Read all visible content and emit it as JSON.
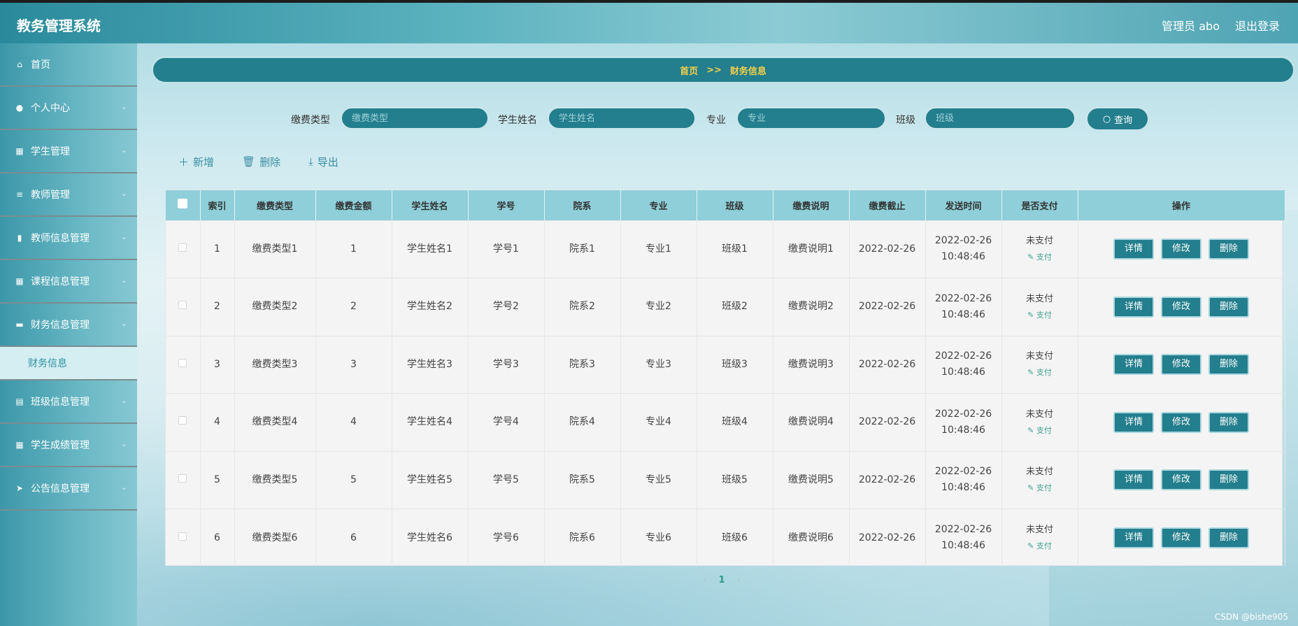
{
  "app": {
    "title": "教务管理系统"
  },
  "header": {
    "user_label": "管理员 abo",
    "logout_label": "退出登录"
  },
  "sidebar": {
    "items": [
      {
        "label": "首页",
        "icon": "home-icon",
        "expandable": false
      },
      {
        "label": "个人中心",
        "icon": "user-icon",
        "expandable": true
      },
      {
        "label": "学生管理",
        "icon": "grid-icon",
        "expandable": true
      },
      {
        "label": "教师管理",
        "icon": "list-icon",
        "expandable": true
      },
      {
        "label": "教师信息管理",
        "icon": "bar-chart-icon",
        "expandable": true
      },
      {
        "label": "课程信息管理",
        "icon": "grid-icon",
        "expandable": true
      },
      {
        "label": "财务信息管理",
        "icon": "wallet-icon",
        "expandable": true
      },
      {
        "label": "班级信息管理",
        "icon": "clipboard-icon",
        "expandable": true
      },
      {
        "label": "学生成绩管理",
        "icon": "grid-icon",
        "expandable": true
      },
      {
        "label": "公告信息管理",
        "icon": "send-icon",
        "expandable": true
      }
    ],
    "active_submenu": {
      "label": "财务信息"
    }
  },
  "breadcrumb": {
    "home": "首页",
    "separator": ">>",
    "current": "财务信息"
  },
  "search": {
    "fee_type": {
      "label": "缴费类型",
      "placeholder": "缴费类型"
    },
    "student_name": {
      "label": "学生姓名",
      "placeholder": "学生姓名"
    },
    "major": {
      "label": "专业",
      "placeholder": "专业"
    },
    "class": {
      "label": "班级",
      "placeholder": "班级"
    },
    "query_label": "查询"
  },
  "toolbar": {
    "add_label": "新增",
    "delete_label": "删除",
    "export_label": "导出"
  },
  "table": {
    "headers": [
      "索引",
      "缴费类型",
      "缴费金额",
      "学生姓名",
      "学号",
      "院系",
      "专业",
      "班级",
      "缴费说明",
      "缴费截止",
      "发送时间",
      "是否支付",
      "操作"
    ],
    "rows": [
      {
        "index": "1",
        "fee_type": "缴费类型1",
        "amount": "1",
        "student_name": "学生姓名1",
        "student_no": "学号1",
        "dept": "院系1",
        "major": "专业1",
        "class": "班级1",
        "desc": "缴费说明1",
        "deadline": "2022-02-26",
        "send_date": "2022-02-26",
        "send_time": "10:48:46",
        "status": "未支付",
        "pay": "支付"
      },
      {
        "index": "2",
        "fee_type": "缴费类型2",
        "amount": "2",
        "student_name": "学生姓名2",
        "student_no": "学号2",
        "dept": "院系2",
        "major": "专业2",
        "class": "班级2",
        "desc": "缴费说明2",
        "deadline": "2022-02-26",
        "send_date": "2022-02-26",
        "send_time": "10:48:46",
        "status": "未支付",
        "pay": "支付"
      },
      {
        "index": "3",
        "fee_type": "缴费类型3",
        "amount": "3",
        "student_name": "学生姓名3",
        "student_no": "学号3",
        "dept": "院系3",
        "major": "专业3",
        "class": "班级3",
        "desc": "缴费说明3",
        "deadline": "2022-02-26",
        "send_date": "2022-02-26",
        "send_time": "10:48:46",
        "status": "未支付",
        "pay": "支付"
      },
      {
        "index": "4",
        "fee_type": "缴费类型4",
        "amount": "4",
        "student_name": "学生姓名4",
        "student_no": "学号4",
        "dept": "院系4",
        "major": "专业4",
        "class": "班级4",
        "desc": "缴费说明4",
        "deadline": "2022-02-26",
        "send_date": "2022-02-26",
        "send_time": "10:48:46",
        "status": "未支付",
        "pay": "支付"
      },
      {
        "index": "5",
        "fee_type": "缴费类型5",
        "amount": "5",
        "student_name": "学生姓名5",
        "student_no": "学号5",
        "dept": "院系5",
        "major": "专业5",
        "class": "班级5",
        "desc": "缴费说明5",
        "deadline": "2022-02-26",
        "send_date": "2022-02-26",
        "send_time": "10:48:46",
        "status": "未支付",
        "pay": "支付"
      },
      {
        "index": "6",
        "fee_type": "缴费类型6",
        "amount": "6",
        "student_name": "学生姓名6",
        "student_no": "学号6",
        "dept": "院系6",
        "major": "专业6",
        "class": "班级6",
        "desc": "缴费说明6",
        "deadline": "2022-02-26",
        "send_date": "2022-02-26",
        "send_time": "10:48:46",
        "status": "未支付",
        "pay": "支付"
      }
    ],
    "row_actions": {
      "detail": "详情",
      "edit": "修改",
      "delete": "删除"
    }
  },
  "pagination": {
    "prev": "‹",
    "current": "1",
    "next": "›"
  },
  "watermark": "CSDN @bishe905",
  "colors": {
    "primary": "#237e8d",
    "header_row": "#8ecfd9",
    "crumb_text": "#f3d04a",
    "pay_link": "#3da08e"
  }
}
